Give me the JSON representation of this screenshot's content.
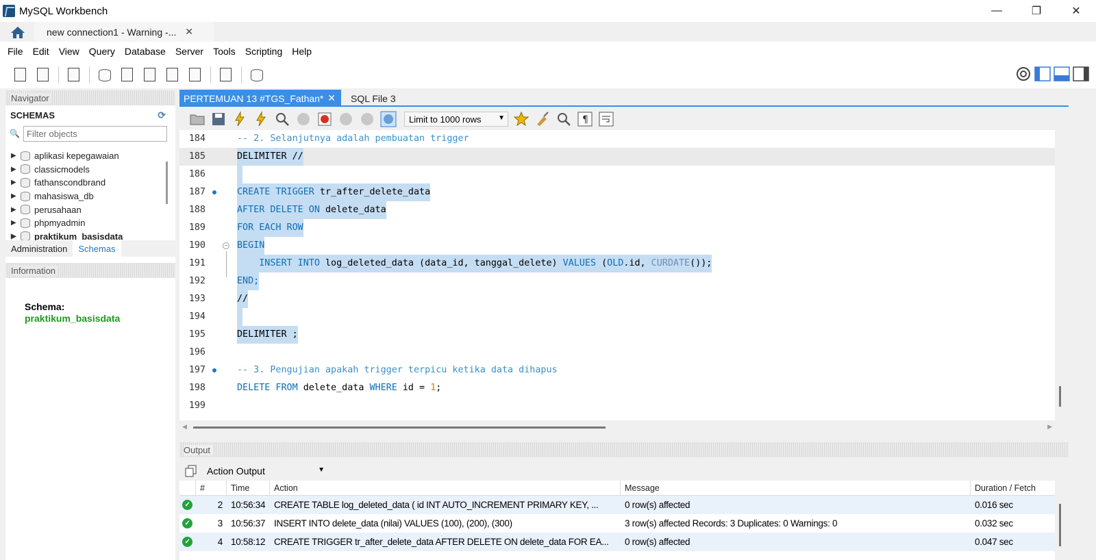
{
  "window": {
    "title": "MySQL Workbench"
  },
  "connection_tab": {
    "label": "new connection1 - Warning -...",
    "close": "✕"
  },
  "menu": [
    "File",
    "Edit",
    "View",
    "Query",
    "Database",
    "Server",
    "Tools",
    "Scripting",
    "Help"
  ],
  "navigator": {
    "header": "Navigator",
    "schemas_title": "SCHEMAS",
    "filter_placeholder": "Filter objects",
    "schemas": [
      {
        "name": "aplikasi kepegawaian",
        "bold": false
      },
      {
        "name": "classicmodels",
        "bold": false
      },
      {
        "name": "fathanscondbrand",
        "bold": false
      },
      {
        "name": "mahasiswa_db",
        "bold": false
      },
      {
        "name": "perusahaan",
        "bold": false
      },
      {
        "name": "phpmyadmin",
        "bold": false
      },
      {
        "name": "praktikum_basisdata",
        "bold": true
      }
    ],
    "tabs": {
      "administration": "Administration",
      "schemas": "Schemas"
    }
  },
  "information": {
    "header": "Information",
    "label": "Schema:",
    "value": "praktikum_basisdata"
  },
  "editor": {
    "tabs": {
      "active": "PERTEMUAN 13 #TGS_Fathan*",
      "other": "SQL File 3",
      "close": "✕"
    },
    "limit": "Limit to 1000 rows"
  },
  "code_lines": [
    {
      "num": "184",
      "marker": false
    },
    {
      "num": "185",
      "marker": false
    },
    {
      "num": "186",
      "marker": false
    },
    {
      "num": "187",
      "marker": true
    },
    {
      "num": "188",
      "marker": false
    },
    {
      "num": "189",
      "marker": false
    },
    {
      "num": "190",
      "marker": false
    },
    {
      "num": "191",
      "marker": false
    },
    {
      "num": "192",
      "marker": false
    },
    {
      "num": "193",
      "marker": false
    },
    {
      "num": "194",
      "marker": false
    },
    {
      "num": "195",
      "marker": false
    },
    {
      "num": "196",
      "marker": false
    },
    {
      "num": "197",
      "marker": true
    },
    {
      "num": "198",
      "marker": false
    },
    {
      "num": "199",
      "marker": false
    }
  ],
  "code_text": {
    "l184": "-- 2. Selanjutnya adalah pembuatan trigger",
    "l185": "DELIMITER //",
    "l187_kw": "CREATE TRIGGER",
    "l187_rest": " tr_after_delete_data",
    "l188_kw": "AFTER DELETE ON",
    "l188_rest": " delete_data",
    "l189": "FOR EACH ROW",
    "l190": "BEGIN",
    "l191_kw1": "INSERT INTO",
    "l191_mid": " log_deleted_data (data_id, tanggal_delete) ",
    "l191_kw2": "VALUES",
    "l191_p1": " (",
    "l191_old": "OLD",
    "l191_p2": ".id, ",
    "l191_fn": "CURDATE",
    "l191_end": "());",
    "l192": "END;",
    "l193": "//",
    "l195": "DELIMITER ;",
    "l197": "-- 3. Pengujian apakah trigger terpicu ketika data dihapus",
    "l198_kw1": "DELETE FROM",
    "l198_mid": " delete_data ",
    "l198_kw2": "WHERE",
    "l198_rest": " id = ",
    "l198_num": "1",
    "l198_end": ";"
  },
  "output": {
    "header": "Output",
    "select": "Action Output",
    "columns": [
      "",
      "#",
      "Time",
      "Action",
      "Message",
      "Duration / Fetch"
    ],
    "rows": [
      {
        "num": "2",
        "time": "10:56:34",
        "action": "CREATE TABLE log_deleted_data (     id INT AUTO_INCREMENT PRIMARY KEY, ...",
        "message": "0 row(s) affected",
        "duration": "0.016 sec"
      },
      {
        "num": "3",
        "time": "10:56:37",
        "action": "INSERT INTO delete_data (nilai) VALUES (100), (200), (300)",
        "message": "3 row(s) affected Records: 3  Duplicates: 0  Warnings: 0",
        "duration": "0.032 sec"
      },
      {
        "num": "4",
        "time": "10:58:12",
        "action": "CREATE TRIGGER tr_after_delete_data AFTER DELETE ON delete_data FOR EA...",
        "message": "0 row(s) affected",
        "duration": "0.047 sec"
      }
    ]
  },
  "colors": {
    "accent": "#3a8ee6",
    "selection": "#c5ddf3",
    "keyword": "#0e6fb3",
    "comment": "#3c8fc8",
    "success": "#21a33b",
    "schema_value": "#1f9a1f"
  }
}
